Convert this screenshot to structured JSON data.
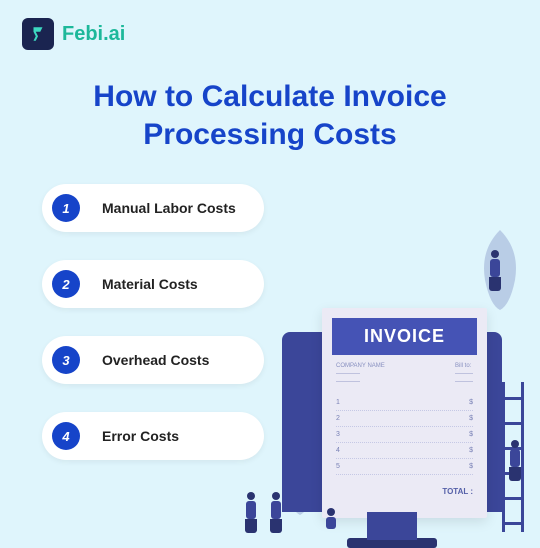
{
  "brand": {
    "name": "Febi.ai"
  },
  "title": "How to Calculate Invoice Processing Costs",
  "items": [
    {
      "num": "1",
      "label": "Manual Labor Costs"
    },
    {
      "num": "2",
      "label": "Material Costs"
    },
    {
      "num": "3",
      "label": "Overhead Costs"
    },
    {
      "num": "4",
      "label": "Error Costs"
    }
  ],
  "invoice": {
    "header": "INVOICE",
    "company_label": "COMPANY NAME",
    "bill_to": "Bill to:",
    "rows": [
      "1",
      "2",
      "3",
      "4",
      "5"
    ],
    "total_label": "TOTAL :"
  }
}
